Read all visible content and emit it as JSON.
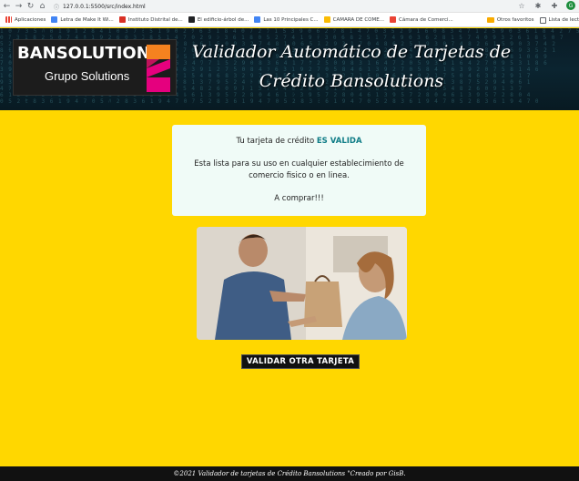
{
  "browser": {
    "url": "127.0.0.1:5500/src/index.html",
    "bookmarks": [
      {
        "label": "Aplicaciones",
        "color": "#5f6368"
      },
      {
        "label": "Letra de Make It Wi...",
        "color": "#4285f4"
      },
      {
        "label": "Instituto Distrital de...",
        "color": "#d93025"
      },
      {
        "label": "El edificio-árbol de...",
        "color": "#202124"
      },
      {
        "label": "Las 10 Principales C...",
        "color": "#4285f4"
      },
      {
        "label": "CAMARA DE COME...",
        "color": "#fbbc04"
      },
      {
        "label": "Cámara de Comerci...",
        "color": "#ea4335"
      }
    ],
    "other_bookmarks": "Otros favoritos",
    "reading_list": "Lista de lect",
    "avatar_letter": "G"
  },
  "header": {
    "logo_top": "BANSOLUTIONS",
    "logo_bottom": "Grupo Solutions",
    "title": "Validador Automático de Tarjetas de Crédito Bansolutions"
  },
  "result": {
    "prefix": "Tu tarjeta de crédito ",
    "status": "ES VALIDA",
    "message": "Esta lista para su uso en cualquier establecimiento de comercio fisico o en linea.",
    "cta": "A comprar!!!"
  },
  "button": {
    "label": "VALIDAR OTRA TARJETA"
  },
  "footer": {
    "text": "©2021 Validador de tarjetas de Crédito Bansolutions \"Creado por GisB."
  },
  "colors": {
    "page_bg": "#ffd700",
    "status": "#0e7c86",
    "logo_orange": "#f5821f",
    "logo_magenta": "#e5007e"
  }
}
